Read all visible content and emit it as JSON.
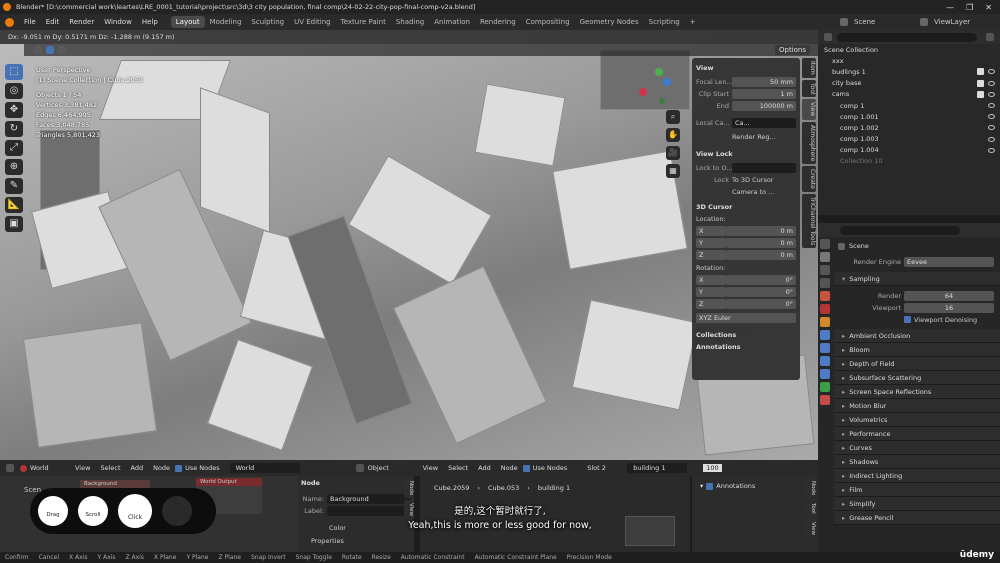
{
  "title_bar": {
    "title": "Blender* [D:\\commercial work\\leartes\\LRE_0001_tutorial\\project\\src\\3d\\3 city population, final comp\\24-02-22-city-pop-final-comp-v2a.blend]"
  },
  "menu": {
    "items": [
      "File",
      "Edit",
      "Render",
      "Window",
      "Help"
    ]
  },
  "workspaces": [
    "Layout",
    "Modeling",
    "Sculpting",
    "UV Editing",
    "Texture Paint",
    "Shading",
    "Animation",
    "Rendering",
    "Compositing",
    "Geometry Nodes",
    "Scripting"
  ],
  "top_right": {
    "scene": "Scene",
    "view_layer": "ViewLayer"
  },
  "viewport": {
    "transform_readout": "Dx: -9.051 m  Dy: 0.5171 m  Dz: -1.288 m (9.157 m)",
    "options_label": "Options",
    "stats": {
      "title": "User Perspective",
      "collection": "(1) Scene Collection | Cube.2059",
      "objects": "Objects 1 / 54",
      "vertices": "Vertices 3,381,482",
      "edges": "Edges 6,464,995",
      "faces": "Faces 3,048,785",
      "triangles": "Triangles 5,801,423"
    },
    "colors": {
      "tool_active": "#4772b3",
      "panel_bg": "#303030"
    }
  },
  "n_panel": {
    "view_header": "View",
    "focal_label": "Focal Len...",
    "focal_value": "50 mm",
    "clip_start_label": "Clip Start",
    "clip_start_value": "1 m",
    "end_label": "End",
    "end_value": "100000 m",
    "local_label": "Local Ca...",
    "local_value": "Ca...",
    "render_region": "Render Reg...",
    "view_lock_header": "View Lock",
    "lock_to_label": "Lock to O...",
    "lock_label": "Lock",
    "lock_cursor": "To 3D Cursor",
    "lock_camera": "Camera to ...",
    "cursor_header": "3D Cursor",
    "location_label": "Location:",
    "x": "X",
    "y": "Y",
    "z": "Z",
    "loc_x": "0 m",
    "loc_y": "0 m",
    "loc_z": "0 m",
    "rotation_label": "Rotation:",
    "rot_x": "0°",
    "rot_y": "0°",
    "rot_z": "0°",
    "euler": "XYZ Euler",
    "collections": "Collections",
    "annotations": "Annotations"
  },
  "side_tabs": [
    "Item",
    "Tool",
    "View",
    "Atmosphere",
    "Create",
    "TriChannel Tools"
  ],
  "outliner": {
    "root": "Scene Collection",
    "items": [
      {
        "name": "xxx"
      },
      {
        "name": "budlings 1"
      },
      {
        "name": "city base"
      },
      {
        "name": "cams"
      },
      {
        "name": "comp 1"
      },
      {
        "name": "comp 1.001"
      },
      {
        "name": "comp 1.002"
      },
      {
        "name": "comp 1.003"
      },
      {
        "name": "comp 1.004"
      },
      {
        "name": "Collection 10"
      }
    ]
  },
  "properties": {
    "scene_label": "Scene",
    "render_engine_label": "Render Engine",
    "render_engine": "Eevee",
    "sampling": "Sampling",
    "render_label": "Render",
    "render_value": "64",
    "viewport_label": "Viewport",
    "viewport_value": "16",
    "viewport_denoising": "Viewport Denoising",
    "sections": [
      "Ambient Occlusion",
      "Bloom",
      "Depth of Field",
      "Subsurface Scattering",
      "Screen Space Reflections",
      "Motion Blur",
      "Volumetrics",
      "Performance",
      "Curves",
      "Shadows",
      "Indirect Lighting",
      "Film",
      "Simplify",
      "Grease Pencil"
    ]
  },
  "node_editor": {
    "world_label": "World",
    "menus": [
      "View",
      "Select",
      "Add",
      "Node"
    ],
    "use_nodes": "Use Nodes",
    "world_name": "World",
    "background_node": "Background",
    "world_output_node": "World Output",
    "scene_label": "Scen",
    "node_panel_header": "Node",
    "name_label": "Name:",
    "name_value": "Background",
    "label_label": "Label:",
    "color_label": "Color",
    "properties_label": "Properties",
    "tab_node": "Node",
    "tab_view": "View"
  },
  "second_editor": {
    "object_label": "Object",
    "menus": [
      "View",
      "Select",
      "Add",
      "Node"
    ],
    "use_nodes": "Use Nodes",
    "slot": "Slot 2",
    "material": "building 1",
    "count": "100",
    "crumb1": "Cube.2059",
    "crumb2": "Cube.053",
    "crumb3": "building 1",
    "annotations": "Annotations",
    "tab_node": "Node",
    "tab_tool": "Tool",
    "tab_view": "View"
  },
  "statusbar": [
    "Confirm",
    "Cancel",
    "X Axis",
    "Y Axis",
    "Z Axis",
    "X Plane",
    "Y Plane",
    "Z Plane",
    "Snap Invert",
    "Snap Toggle",
    "Rotate",
    "Resize",
    "Automatic Constraint",
    "Automatic Constraint Plane",
    "Precision Mode"
  ],
  "overlay": {
    "drag": "Drag",
    "scroll": "Scroll",
    "click": "Click"
  },
  "subtitles": {
    "zh": "是的,这个暂时就行了,",
    "en": "Yeah,this is more or less good for now,"
  },
  "brand": "ūdemy"
}
